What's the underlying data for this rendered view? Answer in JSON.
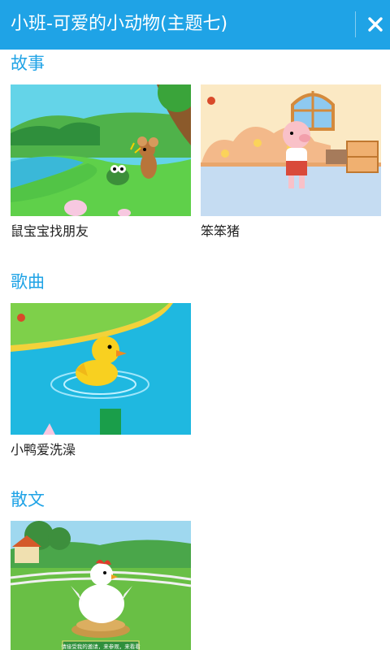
{
  "header": {
    "title": "小班-可爱的小动物(主题七)",
    "close_icon": "close-x-icon",
    "color": "#1fa3e6"
  },
  "sections": [
    {
      "title": "故事",
      "items": [
        {
          "caption": "鼠宝宝找朋友",
          "thumbnail": "mouse-and-frog-by-river"
        },
        {
          "caption": "笨笨猪",
          "thumbnail": "pig-in-room"
        }
      ]
    },
    {
      "title": "歌曲",
      "items": [
        {
          "caption": "小鸭爱洗澡",
          "thumbnail": "duckling-swimming"
        }
      ]
    },
    {
      "title": "散文",
      "items": [
        {
          "caption": "",
          "thumbnail": "hen-on-nest",
          "banner_text": "请接受我的邀请，来参观，来看看"
        }
      ]
    }
  ]
}
